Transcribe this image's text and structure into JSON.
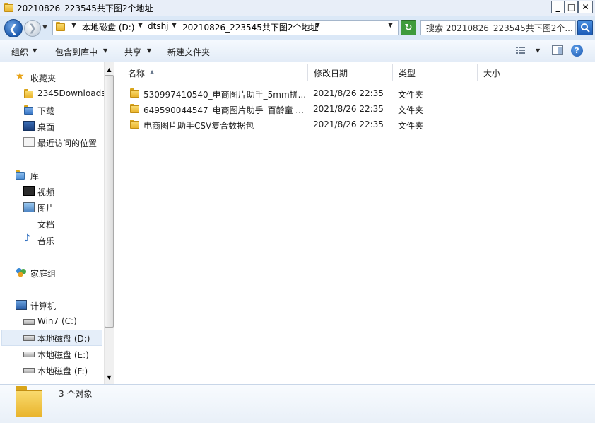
{
  "window": {
    "title": "20210826_223545共下图2个地址",
    "controls": {
      "minimize": "_",
      "maximize": "□",
      "close": "✕"
    }
  },
  "address": {
    "breadcrumbs": [
      "本地磁盘 (D:)",
      "dtshj",
      "20210826_223545共下图2个地址"
    ],
    "search_placeholder": "搜索 20210826_223545共下图2个..."
  },
  "toolbar": {
    "organize": "组织",
    "include_in_library": "包含到库中",
    "share": "共享",
    "new_folder": "新建文件夹"
  },
  "nav": {
    "favorites": {
      "label": "收藏夹",
      "items": [
        "2345Downloads",
        "下载",
        "桌面",
        "最近访问的位置"
      ]
    },
    "libraries": {
      "label": "库",
      "items": [
        "视频",
        "图片",
        "文档",
        "音乐"
      ]
    },
    "homegroup": {
      "label": "家庭组"
    },
    "computer": {
      "label": "计算机",
      "items": [
        "Win7 (C:)",
        "本地磁盘 (D:)",
        "本地磁盘 (E:)",
        "本地磁盘 (F:)"
      ]
    }
  },
  "columns": {
    "name": "名称",
    "modified": "修改日期",
    "type": "类型",
    "size": "大小"
  },
  "files": [
    {
      "name": "530997410540_电商图片助手_5mm拼...",
      "modified": "2021/8/26 22:35",
      "type": "文件夹",
      "size": ""
    },
    {
      "name": "649590044547_电商图片助手_百龄童 ...",
      "modified": "2021/8/26 22:35",
      "type": "文件夹",
      "size": ""
    },
    {
      "name": "电商图片助手CSV复合数据包",
      "modified": "2021/8/26 22:35",
      "type": "文件夹",
      "size": ""
    }
  ],
  "status": {
    "count": "3 个对象"
  },
  "colors": {
    "titlebar": "#e8eef8",
    "selection": "#e5eef9",
    "folder": "#f0c445"
  }
}
